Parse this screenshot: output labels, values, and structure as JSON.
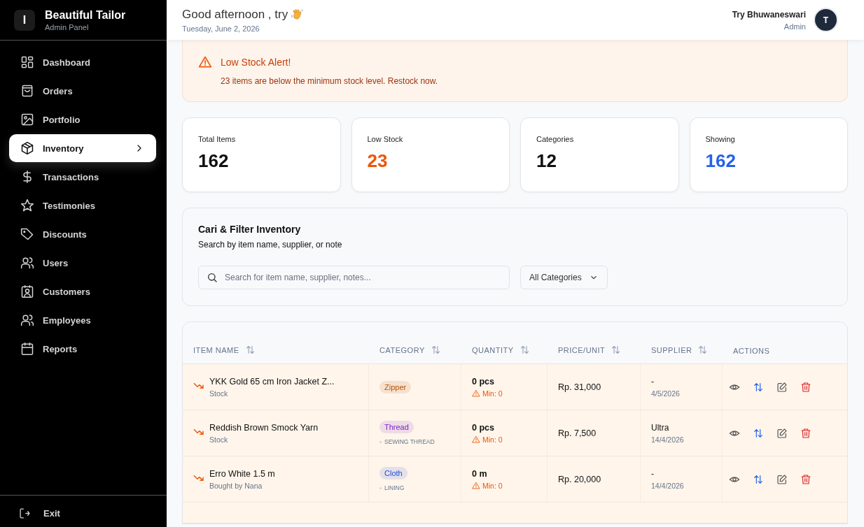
{
  "brand": {
    "logo_letter": "I",
    "title": "Beautiful Tailor",
    "subtitle": "Admin Panel"
  },
  "nav": [
    {
      "label": "Dashboard",
      "selected": false
    },
    {
      "label": "Orders",
      "selected": false
    },
    {
      "label": "Portfolio",
      "selected": false
    },
    {
      "label": "Inventory",
      "selected": true
    },
    {
      "label": "Transactions",
      "selected": false
    },
    {
      "label": "Testimonies",
      "selected": false
    },
    {
      "label": "Discounts",
      "selected": false
    },
    {
      "label": "Users",
      "selected": false
    },
    {
      "label": "Customers",
      "selected": false
    },
    {
      "label": "Employees",
      "selected": false
    },
    {
      "label": "Reports",
      "selected": false
    }
  ],
  "exit": {
    "label": "Exit"
  },
  "header": {
    "greeting": "Good afternoon , try",
    "date": "Tuesday, June 2, 2026",
    "user_name": "Try Bhuwaneswari",
    "user_role": "Admin",
    "avatar_letter": "T"
  },
  "alert": {
    "title": "Low Stock Alert!",
    "message": "23 items are below the minimum stock level. Restock now."
  },
  "stats": [
    {
      "label": "Total Items",
      "value": "162",
      "color": "#111111"
    },
    {
      "label": "Low Stock",
      "value": "23",
      "color": "#ea580c"
    },
    {
      "label": "Categories",
      "value": "12",
      "color": "#111111"
    },
    {
      "label": "Showing",
      "value": "162",
      "color": "#2563eb"
    }
  ],
  "filter": {
    "title": "Cari & Filter Inventory",
    "subtitle": "Search by item name, supplier, or note",
    "search_placeholder": "Search for item name, supplier, notes...",
    "category_select": "All Categories"
  },
  "table": {
    "columns": [
      {
        "label": "ITEM NAME",
        "sortable": true
      },
      {
        "label": "CATEGORY",
        "sortable": true
      },
      {
        "label": "QUANTITY",
        "sortable": true
      },
      {
        "label": "PRICE/UNIT",
        "sortable": true
      },
      {
        "label": "SUPPLIER",
        "sortable": true
      },
      {
        "label": "ACTIONS",
        "sortable": false
      }
    ],
    "rows": [
      {
        "name": "YKK Gold 65 cm Iron Jacket Z...",
        "note": "Stock",
        "low_stock": true,
        "category": "Zipper",
        "color": "#b45309",
        "subcategory": null,
        "quantity": "0 pcs",
        "minimum": "Min: 0",
        "price": "Rp. 31,000",
        "supplier": "-",
        "date": "4/5/2026"
      },
      {
        "name": "Reddish Brown Smock Yarn",
        "note": "Stock",
        "low_stock": true,
        "category": "Thread",
        "color": "#7e22ce",
        "subcategory": "SEWING THREAD",
        "quantity": "0 pcs",
        "minimum": "Min: 0",
        "price": "Rp. 7,500",
        "supplier": "Ultra",
        "date": "14/4/2026"
      },
      {
        "name": "Erro White 1.5 m",
        "note": "Bought by Nana",
        "low_stock": true,
        "category": "Cloth",
        "color": "#1d4ed8",
        "subcategory": "LINING",
        "quantity": "0 m",
        "minimum": "Min: 0",
        "price": "Rp. 20,000",
        "supplier": "-",
        "date": "14/4/2026"
      }
    ]
  }
}
